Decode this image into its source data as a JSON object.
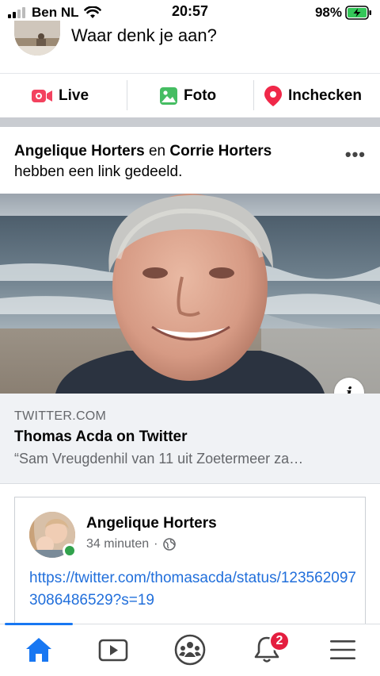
{
  "status_bar": {
    "carrier": "Ben NL",
    "time": "20:57",
    "battery": "98%"
  },
  "composer": {
    "placeholder": "Waar denk je aan?"
  },
  "actions": [
    {
      "label": "Live",
      "icon": "live-video-icon",
      "color": "#f3425f"
    },
    {
      "label": "Foto",
      "icon": "photo-icon",
      "color": "#45bd62"
    },
    {
      "label": "Inchecken",
      "icon": "location-pin-icon",
      "color": "#f02849"
    }
  ],
  "post": {
    "author1": "Angelique Horters",
    "connector": " en ",
    "author2": "Corrie Horters",
    "action_text": "hebben een link gedeeld.",
    "more": "•••"
  },
  "link": {
    "domain": "TWITTER.COM",
    "title": "Thomas Acda on Twitter",
    "description": "“Sam Vreugdenhil van 11 uit Zoetermeer za…",
    "info": "i"
  },
  "embed": {
    "name": "Angelique Horters",
    "time": "34 minuten",
    "separator": "·",
    "url": "https://twitter.com/thomasacda/status/1235620973086486529?s=19"
  },
  "nav": {
    "items": [
      "home-icon",
      "watch-icon",
      "groups-icon",
      "notifications-icon",
      "menu-icon"
    ],
    "notification_count": "2",
    "accent": "#1877f2"
  }
}
